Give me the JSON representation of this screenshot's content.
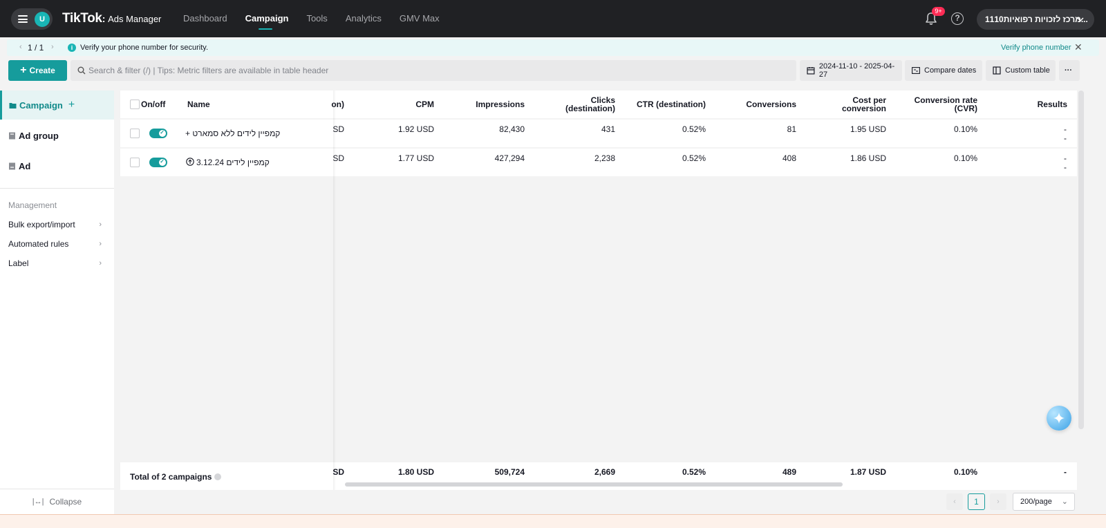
{
  "topbar": {
    "avatar_letter": "U",
    "brand_main": "TikTok",
    "brand_separator": ":",
    "brand_sub": "Ads Manager",
    "nav": [
      {
        "label": "Dashboard",
        "active": false
      },
      {
        "label": "Campaign",
        "active": true
      },
      {
        "label": "Tools",
        "active": false
      },
      {
        "label": "Analytics",
        "active": false
      },
      {
        "label": "GMV Max",
        "active": false
      }
    ],
    "notification_badge": "9+",
    "help_symbol": "?",
    "account_name": "1110מרכז לזכויות רפואיות..."
  },
  "notice": {
    "pager": "1 / 1",
    "info_symbol": "i",
    "message": "Verify your phone number for security.",
    "action": "Verify phone number",
    "close_symbol": "✕"
  },
  "toolbar": {
    "create_label": "Create",
    "search_placeholder": "Search & filter (/) | Tips: Metric filters are available in table header",
    "date_range": "2024-11-10 - 2025-04-27",
    "compare_label": "Compare dates",
    "custom_table_label": "Custom table",
    "more_label": "···"
  },
  "sidebar": {
    "levels": [
      {
        "label": "Campaign",
        "active": true
      },
      {
        "label": "Ad group",
        "active": false
      },
      {
        "label": "Ad",
        "active": false
      }
    ],
    "add_symbol": "+",
    "management_heading": "Management",
    "links": [
      {
        "label": "Bulk export/import"
      },
      {
        "label": "Automated rules"
      },
      {
        "label": "Label"
      }
    ],
    "collapse_label": "Collapse"
  },
  "table": {
    "headers": {
      "onoff": "On/off",
      "name": "Name",
      "cost_partial": "on)",
      "cpm": "CPM",
      "impressions": "Impressions",
      "clicks_l1": "Clicks",
      "clicks_l2": "(destination)",
      "ctr": "CTR (destination)",
      "conversions": "Conversions",
      "cpc_l1": "Cost per",
      "cpc_l2": "conversion",
      "cvr_l1": "Conversion rate",
      "cvr_l2": "(CVR)",
      "results": "Results"
    },
    "rows": [
      {
        "name": "קמפיין לידים ללא סמארט +",
        "cost_partial": "SD",
        "cpm": "1.92 USD",
        "impressions": "82,430",
        "clicks": "431",
        "ctr": "0.52%",
        "conversions": "81",
        "cost_per_conversion": "1.95 USD",
        "cvr": "0.10%",
        "results_1": "-",
        "results_2": "-"
      },
      {
        "name": "קמפיין לידים 3.12.24",
        "cost_partial": "SD",
        "cpm": "1.77 USD",
        "impressions": "427,294",
        "clicks": "2,238",
        "ctr": "0.52%",
        "conversions": "408",
        "cost_per_conversion": "1.86 USD",
        "cvr": "0.10%",
        "results_1": "-",
        "results_2": "-"
      }
    ],
    "total": {
      "label": "Total of 2 campaigns",
      "cost_partial": "SD",
      "cpm": "1.80 USD",
      "impressions": "509,724",
      "clicks": "2,669",
      "ctr": "0.52%",
      "conversions": "489",
      "cost_per_conversion": "1.87 USD",
      "cvr": "0.10%",
      "results": "-"
    }
  },
  "pagination": {
    "current_page": "1",
    "page_size": "200/page",
    "prev_symbol": "‹",
    "next_symbol": "›"
  },
  "colors": {
    "accent": "#169c9c",
    "topbar_bg": "#202124",
    "badge": "#fe2c55",
    "notice_bg": "#e8f7f7"
  },
  "icons": [
    "menu-icon",
    "bell-icon",
    "help-icon",
    "chevron-down-icon",
    "info-icon",
    "close-icon",
    "plus-icon",
    "search-icon",
    "calendar-icon",
    "compare-icon",
    "columns-icon",
    "folder-icon",
    "ad-group-icon",
    "ad-icon",
    "chevron-right-icon",
    "collapse-icon",
    "upload-icon",
    "sparkle-icon"
  ]
}
